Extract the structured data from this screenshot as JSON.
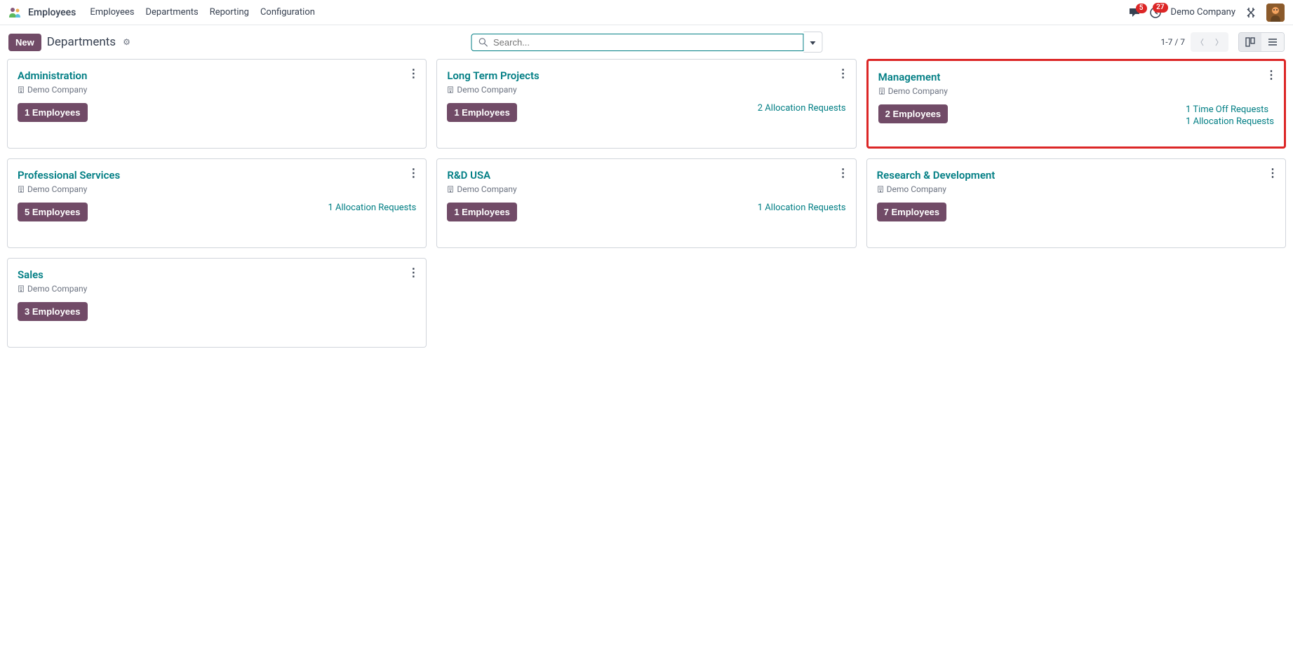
{
  "header": {
    "app_title": "Employees",
    "menu": [
      "Employees",
      "Departments",
      "Reporting",
      "Configuration"
    ],
    "messaging_badge": "5",
    "activity_badge": "27",
    "company": "Demo Company"
  },
  "controlbar": {
    "new_label": "New",
    "breadcrumb": "Departments",
    "search_placeholder": "Search...",
    "pager": "1-7 / 7"
  },
  "departments": [
    {
      "title": "Administration",
      "company": "Demo Company",
      "emp_label": "1 Employees",
      "links": [],
      "highlighted": false
    },
    {
      "title": "Long Term Projects",
      "company": "Demo Company",
      "emp_label": "1 Employees",
      "links": [
        "2 Allocation Requests"
      ],
      "highlighted": false
    },
    {
      "title": "Management",
      "company": "Demo Company",
      "emp_label": "2 Employees",
      "links": [
        "1 Time Off Requests",
        "1 Allocation Requests"
      ],
      "highlighted": true
    },
    {
      "title": "Professional Services",
      "company": "Demo Company",
      "emp_label": "5 Employees",
      "links": [
        "1 Allocation Requests"
      ],
      "highlighted": false
    },
    {
      "title": "R&D USA",
      "company": "Demo Company",
      "emp_label": "1 Employees",
      "links": [
        "1 Allocation Requests"
      ],
      "highlighted": false
    },
    {
      "title": "Research & Development",
      "company": "Demo Company",
      "emp_label": "7 Employees",
      "links": [],
      "highlighted": false
    },
    {
      "title": "Sales",
      "company": "Demo Company",
      "emp_label": "3 Employees",
      "links": [],
      "highlighted": false
    }
  ]
}
